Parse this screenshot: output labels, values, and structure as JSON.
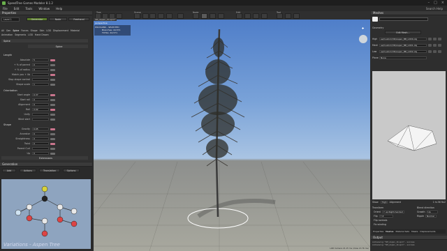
{
  "app": {
    "title": "SpeedTree Games Modeler 8.1.2",
    "search": "Search Help"
  },
  "menu": [
    "File",
    "Edit",
    "Tools",
    "Window",
    "Help"
  ],
  "properties": {
    "title": "Properties",
    "level": "Level 1",
    "modes": [
      "Generator",
      "Node",
      "Freehand"
    ],
    "tabs": [
      "All",
      "Gen",
      "Spine",
      "Forces",
      "Shape",
      "Skin",
      "LOD",
      "Displacement",
      "Material",
      "Animation",
      "Segments",
      "LOD",
      "Hand Drawn"
    ],
    "spine_header": "Spine",
    "length_section": "Length",
    "length_rows": [
      {
        "label": "Absolute",
        "value": "5"
      },
      {
        "label": "+ % of parent",
        "value": "0"
      },
      {
        "label": "+ % of radius",
        "value": "0"
      },
      {
        "label": "Match you + lib",
        "value": ""
      },
      {
        "label": "Stop shape control",
        "value": ""
      },
      {
        "label": "Shape scale",
        "value": "1"
      }
    ],
    "orientation_section": "Orientation",
    "orientation_rows": [
      {
        "label": "Start angle",
        "value": "0.37"
      },
      {
        "label": "Start roll",
        "value": "0"
      },
      {
        "label": "Alignment",
        "value": "0"
      },
      {
        "label": "Roll",
        "value": "0.02"
      },
      {
        "label": "Unify",
        "value": ""
      },
      {
        "label": "Wind start",
        "value": ""
      }
    ],
    "shape_section": "Shape",
    "shape_rows": [
      {
        "label": "Gravity",
        "value": "0.05"
      },
      {
        "label": "Ancestor",
        "value": "0"
      },
      {
        "label": "Straightness",
        "value": "0"
      },
      {
        "label": "Twist",
        "value": "0"
      },
      {
        "label": "Parent Curl",
        "value": ""
      },
      {
        "label": "Up",
        "value": "0"
      }
    ],
    "extensions": "Extensions"
  },
  "generation": {
    "title": "Generation",
    "buttons": [
      "Add",
      "Actions",
      "Translation",
      "Options"
    ],
    "caption": "Variations - Aspen Tree"
  },
  "toolbar": {
    "groups": [
      "Tree",
      "Scene",
      "Node",
      "Edit",
      "Tool"
    ]
  },
  "viewport": {
    "tab": "SM_Aspen_1b.spm*",
    "label": "perspective",
    "overlay_title": "POLYGONS - SELECTED",
    "overlay_l1": "Branches: 44,571",
    "overlay_l2": "TOTAL: 44,571",
    "status": "LOD Camera 21.15 ms (draw 13.76 ms)"
  },
  "meshes": {
    "title": "Meshes",
    "geometry": "Geometry",
    "edit_button": "Edit Mesh...",
    "rows": [
      {
        "label": "High",
        "value": "es/Custom/3D/Aspen_BB_LOD0.obj"
      },
      {
        "label": "Medi",
        "value": "es/Custom/3D/Aspen_BB_LOD1.obj"
      },
      {
        "label": "Low",
        "value": "es/Custom/3D/Aspen_BB_LOD2.obj"
      },
      {
        "label": "Plane",
        "value": "None"
      }
    ],
    "show": "Show",
    "show_value": "High",
    "alignment": "Alignment",
    "transform": "Transform",
    "orient": "Orient",
    "orient_value": "Y up Right-handed",
    "flip": "Flip",
    "flip_value": "Y Z",
    "flip_normals": "Flip normals",
    "fix_winding": "Fix winding",
    "blend": "Blend direction",
    "growth": "Growth",
    "growth_value": "Up",
    "ripple": "Ripple",
    "ripple_value": "Normal",
    "tabs": [
      "Properties",
      "Meshes",
      "Material Sets",
      "Masks",
      "Displacements"
    ],
    "count": "1 hi-56 ftx2",
    "output": "Output",
    "output_lines": [
      "Autosaving: \"SM_Aspen_1b.spm\"... success",
      "Autosaving: \"SM_Aspen_1b.spm\"... success"
    ]
  }
}
